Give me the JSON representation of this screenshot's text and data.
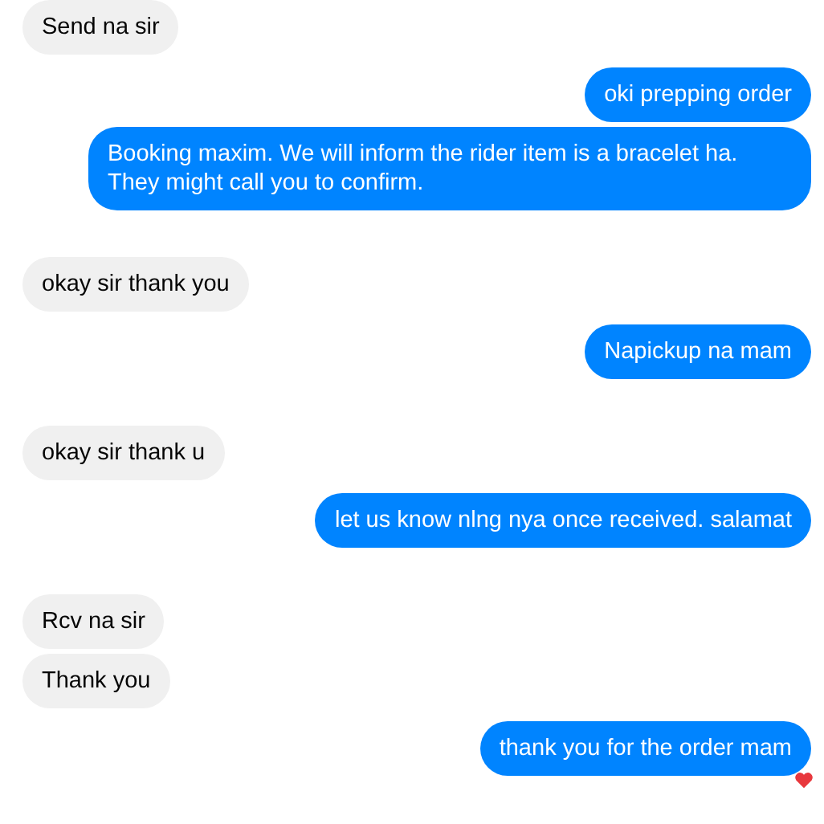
{
  "conversation": [
    {
      "messages": [
        {
          "kind": "incoming",
          "text": "Send na sir"
        },
        {
          "kind": "outgoing",
          "text": "oki prepping order"
        },
        {
          "kind": "outgoing",
          "text": "Booking maxim. We will inform the rider item is a bracelet ha. They might call you to confirm."
        }
      ]
    },
    {
      "messages": [
        {
          "kind": "incoming",
          "text": "okay sir thank you"
        },
        {
          "kind": "outgoing",
          "text": "Napickup na mam"
        }
      ]
    },
    {
      "messages": [
        {
          "kind": "incoming",
          "text": "okay sir thank u"
        },
        {
          "kind": "outgoing",
          "text": "let us know nlng nya once received. salamat"
        }
      ]
    },
    {
      "messages": [
        {
          "kind": "incoming",
          "text": "Rcv na sir"
        },
        {
          "kind": "incoming",
          "text": "Thank you"
        },
        {
          "kind": "outgoing",
          "text": "thank you for the order mam",
          "hearted": true
        }
      ]
    }
  ]
}
